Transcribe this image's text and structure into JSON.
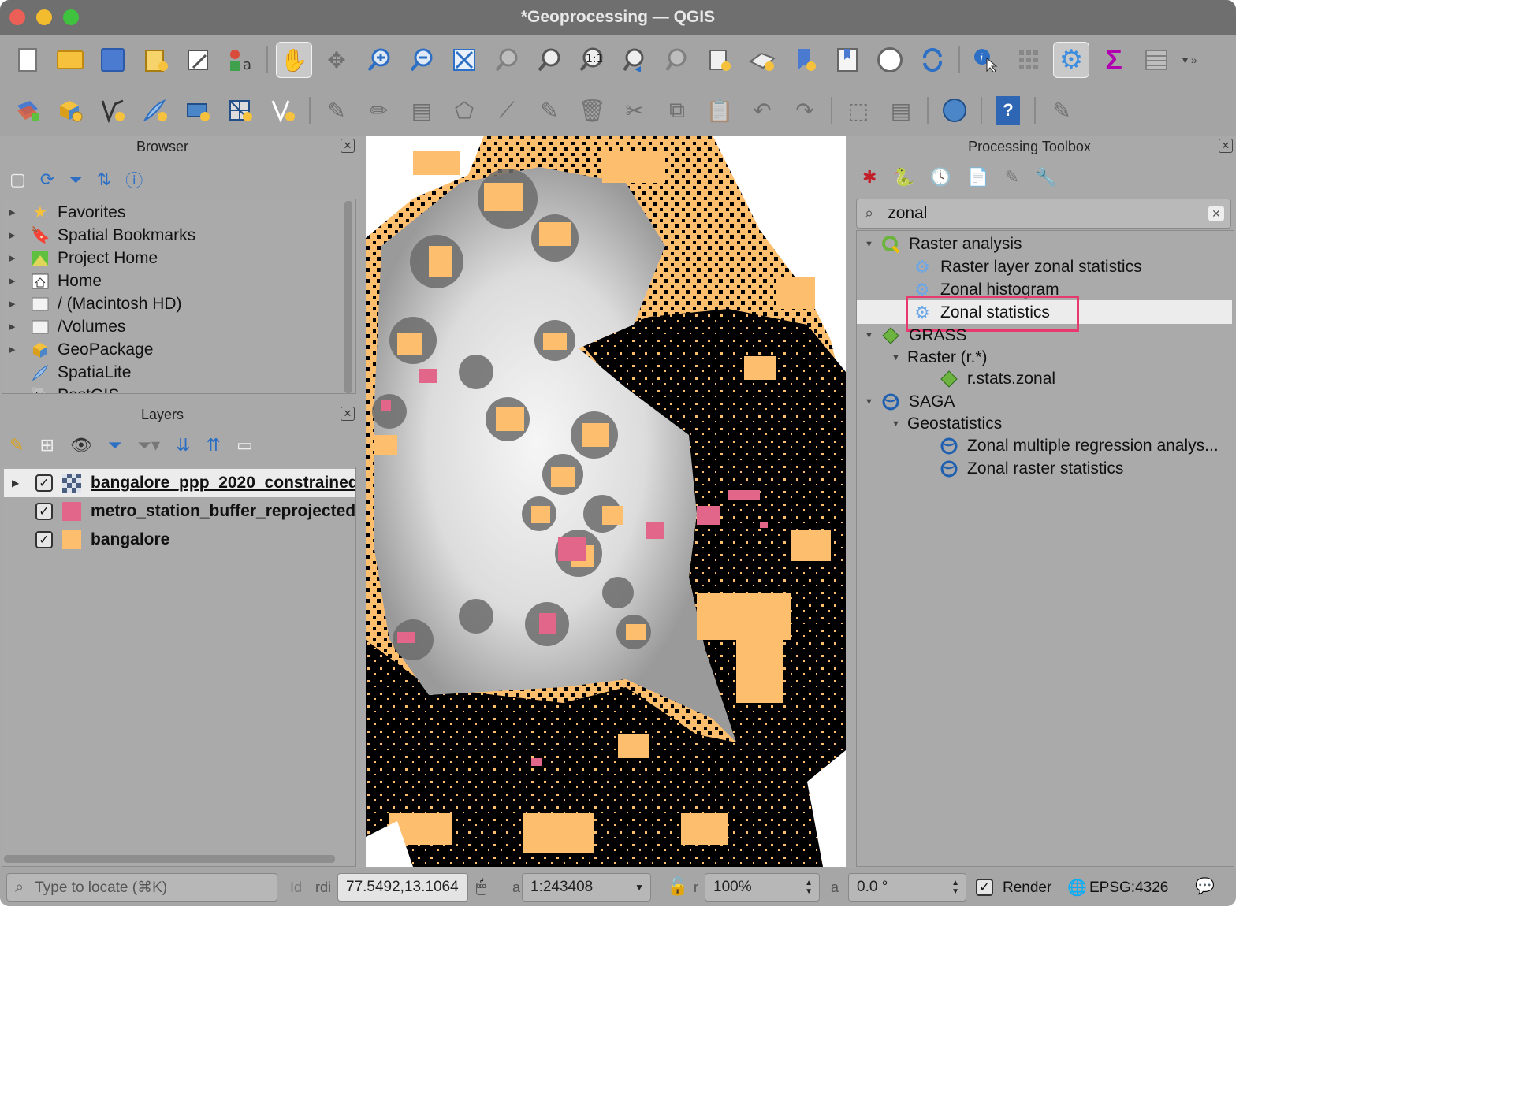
{
  "window": {
    "title": "*Geoprocessing — QGIS"
  },
  "toolbar1": [
    {
      "name": "new-project-icon"
    },
    {
      "name": "open-project-icon"
    },
    {
      "name": "save-project-icon"
    },
    {
      "name": "new-print-layout-icon"
    },
    {
      "name": "layout-manager-icon"
    },
    {
      "name": "style-manager-icon"
    },
    {
      "name": "pan-icon"
    },
    {
      "name": "pan-to-selection-icon"
    },
    {
      "name": "zoom-in-icon"
    },
    {
      "name": "zoom-out-icon"
    },
    {
      "name": "zoom-full-icon"
    },
    {
      "name": "zoom-to-selection-icon"
    },
    {
      "name": "zoom-to-layer-icon"
    },
    {
      "name": "zoom-native-icon"
    },
    {
      "name": "zoom-last-icon"
    },
    {
      "name": "zoom-next-icon"
    },
    {
      "name": "new-map-view-icon"
    },
    {
      "name": "new-3d-map-view-icon"
    },
    {
      "name": "new-bookmark-icon"
    },
    {
      "name": "show-bookmarks-icon"
    },
    {
      "name": "temporal-controller-icon"
    },
    {
      "name": "refresh-icon"
    },
    {
      "name": "identify-features-icon"
    },
    {
      "name": "attributes-toolbar-icon"
    },
    {
      "name": "processing-toolbox-icon"
    },
    {
      "name": "statistical-summary-icon"
    },
    {
      "name": "attribute-table-icon"
    }
  ],
  "browser": {
    "title": "Browser",
    "items": [
      {
        "label": "Favorites",
        "icon": "star-icon"
      },
      {
        "label": "Spatial Bookmarks",
        "icon": "bookmark-icon"
      },
      {
        "label": "Project Home",
        "icon": "project-home-icon"
      },
      {
        "label": "Home",
        "icon": "home-icon"
      },
      {
        "label": "/ (Macintosh HD)",
        "icon": "folder-icon"
      },
      {
        "label": "/Volumes",
        "icon": "folder-icon"
      },
      {
        "label": "GeoPackage",
        "icon": "geopackage-icon"
      },
      {
        "label": "SpatiaLite",
        "icon": "spatialite-icon"
      },
      {
        "label": "PostGIS",
        "icon": "postgis-icon"
      }
    ]
  },
  "layers": {
    "title": "Layers",
    "items": [
      {
        "label": "bangalore_ppp_2020_constrained",
        "color": "#555555"
      },
      {
        "label": "metro_station_buffer_reprojected",
        "color": "#e2668a"
      },
      {
        "label": "bangalore",
        "color": "#fdbe6e"
      }
    ]
  },
  "toolbox": {
    "title": "Processing Toolbox",
    "search_value": "zonal",
    "groups": [
      {
        "label": "Raster analysis",
        "children": [
          "Raster layer zonal statistics",
          "Zonal histogram",
          "Zonal statistics"
        ]
      },
      {
        "label": "GRASS",
        "sub": "Raster (r.*)",
        "children": [
          "r.stats.zonal"
        ]
      },
      {
        "label": "SAGA",
        "sub": "Geostatistics",
        "children": [
          "Zonal multiple regression analys...",
          "Zonal raster statistics"
        ]
      }
    ],
    "highlight_color": "#e8396f"
  },
  "status": {
    "locate_placeholder": "Type to locate (⌘K)",
    "coord_label": "rdi",
    "coordinate": "77.5492,13.1064",
    "scale_label": "a",
    "scale": "1:243408",
    "mag_label": "r",
    "magnifier": "100%",
    "rot_label": "a",
    "rotation": "0.0 °",
    "render_label": "Render",
    "crs": "EPSG:4326",
    "id_label": "Id"
  }
}
